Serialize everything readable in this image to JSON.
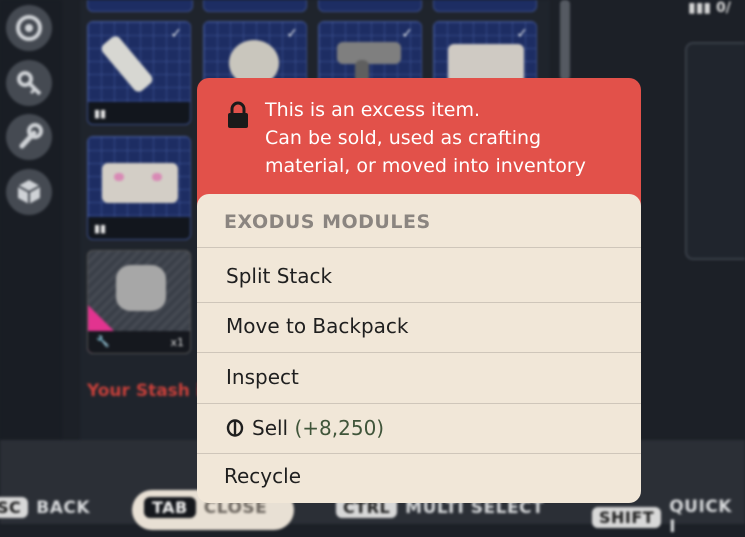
{
  "popup": {
    "warning_lines": [
      "This is an excess item.",
      "Can be sold, used as crafting",
      "material, or moved into inventory"
    ],
    "category": "EXODUS MODULES",
    "items": [
      {
        "label": "Split Stack"
      },
      {
        "label": "Move to Backpack"
      },
      {
        "label": "Inspect"
      },
      {
        "label": "Sell",
        "amount": "(+8,250)"
      },
      {
        "label": "Recycle"
      }
    ]
  },
  "stash": {
    "warning_partial": "Your Stash i",
    "special_slot_qty": "x1"
  },
  "bottom_hints": [
    {
      "key": "SC",
      "label": "BACK"
    },
    {
      "key": "TAB",
      "label": "CLOSE"
    },
    {
      "key": "CTRL",
      "label": "MULTI SELECT"
    },
    {
      "key": "SHIFT",
      "label": "QUICK I"
    }
  ],
  "colors": {
    "warning_bg": "#e2514a",
    "menu_bg": "#f1e7d8",
    "sell_amount": "#40553a",
    "slot_blue": "#1d2d63",
    "special_pink": "#e2338f"
  },
  "icons": [
    "lock-icon",
    "coin-icon",
    "eye-icon",
    "key-icon",
    "wrench-icon",
    "cube-icon",
    "check-icon",
    "blueprint-icon"
  ]
}
